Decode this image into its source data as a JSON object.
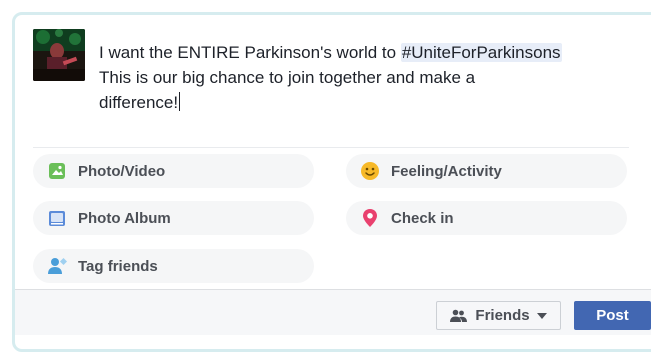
{
  "composer": {
    "text_lines": [
      "I want the ENTIRE Parkinson's world to ",
      "This is our big chance to join together and make a",
      "difference!"
    ],
    "hashtag": "#UniteForParkinsons"
  },
  "actions": {
    "photo_video": {
      "label": "Photo/Video",
      "icon": "photo-video-icon",
      "color": "#6bbf59"
    },
    "feeling_activity": {
      "label": "Feeling/Activity",
      "icon": "smiley-icon",
      "color": "#f7b928"
    },
    "photo_album": {
      "label": "Photo Album",
      "icon": "photo-album-icon",
      "color": "#5b8bd9"
    },
    "check_in": {
      "label": "Check in",
      "icon": "location-pin-icon",
      "color": "#e9416f"
    },
    "tag_friends": {
      "label": "Tag friends",
      "icon": "tag-friends-icon",
      "color": "#4a9ed9"
    }
  },
  "footer": {
    "audience_label": "Friends",
    "post_label": "Post",
    "post_color": "#4267b2"
  }
}
